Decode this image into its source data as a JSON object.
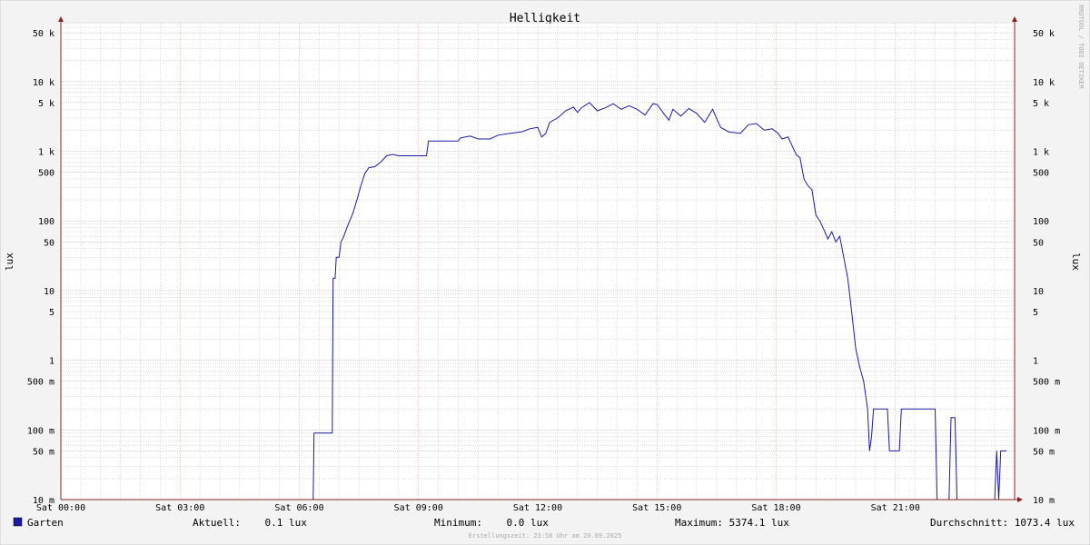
{
  "colors": {
    "background": "#f3f3f3",
    "canvas": "#ffffff",
    "major_grid": "#e6a0a0",
    "minor_grid": "#cccccc",
    "axis": "#8b2020",
    "series": "#1a1aa6",
    "text": "#000000",
    "watermark": "#aaaaaa"
  },
  "chart_data": {
    "type": "line",
    "title": "Helligkeit",
    "ylabel_left": "lux",
    "ylabel_right": "lux",
    "y_scale": "log",
    "ylim": [
      0.01,
      70000
    ],
    "xlim": [
      "00:00",
      "24:00"
    ],
    "x_ticks": [
      {
        "label": "Sat 00:00",
        "hour": 0
      },
      {
        "label": "Sat 03:00",
        "hour": 3
      },
      {
        "label": "Sat 06:00",
        "hour": 6
      },
      {
        "label": "Sat 09:00",
        "hour": 9
      },
      {
        "label": "Sat 12:00",
        "hour": 12
      },
      {
        "label": "Sat 15:00",
        "hour": 15
      },
      {
        "label": "Sat 18:00",
        "hour": 18
      },
      {
        "label": "Sat 21:00",
        "hour": 21
      }
    ],
    "y_ticks": [
      {
        "label": "50 k",
        "value": 50000
      },
      {
        "label": "10 k",
        "value": 10000
      },
      {
        "label": "5 k",
        "value": 5000
      },
      {
        "label": "1 k",
        "value": 1000
      },
      {
        "label": "500",
        "value": 500
      },
      {
        "label": "100",
        "value": 100
      },
      {
        "label": "50",
        "value": 50
      },
      {
        "label": "10",
        "value": 10
      },
      {
        "label": "5",
        "value": 5
      },
      {
        "label": "1",
        "value": 1
      },
      {
        "label": "500 m",
        "value": 0.5
      },
      {
        "label": "100 m",
        "value": 0.1
      },
      {
        "label": "50 m",
        "value": 0.05
      },
      {
        "label": "10 m",
        "value": 0.01
      }
    ],
    "grid": true,
    "legend": "bottom-left",
    "series": [
      {
        "name": "Garten",
        "color": "#1a1aa6",
        "points": [
          [
            0.0,
            0.01
          ],
          [
            6.35,
            0.01
          ],
          [
            6.37,
            0.09
          ],
          [
            6.83,
            0.09
          ],
          [
            6.85,
            15
          ],
          [
            6.9,
            15
          ],
          [
            6.93,
            30
          ],
          [
            7.0,
            30
          ],
          [
            7.05,
            50
          ],
          [
            7.12,
            60
          ],
          [
            7.18,
            75
          ],
          [
            7.25,
            95
          ],
          [
            7.35,
            130
          ],
          [
            7.45,
            200
          ],
          [
            7.55,
            320
          ],
          [
            7.65,
            480
          ],
          [
            7.75,
            580
          ],
          [
            7.9,
            600
          ],
          [
            8.05,
            700
          ],
          [
            8.2,
            860
          ],
          [
            8.35,
            900
          ],
          [
            8.5,
            860
          ],
          [
            8.8,
            860
          ],
          [
            9.2,
            860
          ],
          [
            9.25,
            1400
          ],
          [
            9.8,
            1400
          ],
          [
            10.0,
            1400
          ],
          [
            10.05,
            1550
          ],
          [
            10.3,
            1650
          ],
          [
            10.5,
            1500
          ],
          [
            10.8,
            1500
          ],
          [
            11.0,
            1700
          ],
          [
            11.3,
            1800
          ],
          [
            11.6,
            1900
          ],
          [
            11.8,
            2100
          ],
          [
            12.0,
            2200
          ],
          [
            12.1,
            1600
          ],
          [
            12.2,
            1800
          ],
          [
            12.3,
            2600
          ],
          [
            12.5,
            3000
          ],
          [
            12.7,
            3800
          ],
          [
            12.9,
            4300
          ],
          [
            13.0,
            3600
          ],
          [
            13.1,
            4200
          ],
          [
            13.3,
            5000
          ],
          [
            13.5,
            3800
          ],
          [
            13.7,
            4200
          ],
          [
            13.9,
            4800
          ],
          [
            14.1,
            4000
          ],
          [
            14.3,
            4500
          ],
          [
            14.5,
            4000
          ],
          [
            14.7,
            3300
          ],
          [
            14.9,
            4800
          ],
          [
            15.0,
            4700
          ],
          [
            15.2,
            3300
          ],
          [
            15.3,
            2800
          ],
          [
            15.4,
            4000
          ],
          [
            15.6,
            3200
          ],
          [
            15.8,
            4100
          ],
          [
            16.0,
            3500
          ],
          [
            16.2,
            2600
          ],
          [
            16.4,
            4000
          ],
          [
            16.6,
            2200
          ],
          [
            16.8,
            1900
          ],
          [
            17.1,
            1800
          ],
          [
            17.3,
            2400
          ],
          [
            17.5,
            2500
          ],
          [
            17.7,
            2000
          ],
          [
            17.9,
            2100
          ],
          [
            18.05,
            1800
          ],
          [
            18.15,
            1500
          ],
          [
            18.3,
            1600
          ],
          [
            18.4,
            1200
          ],
          [
            18.5,
            900
          ],
          [
            18.6,
            800
          ],
          [
            18.7,
            400
          ],
          [
            18.8,
            320
          ],
          [
            18.9,
            280
          ],
          [
            19.0,
            120
          ],
          [
            19.1,
            100
          ],
          [
            19.2,
            75
          ],
          [
            19.3,
            55
          ],
          [
            19.4,
            70
          ],
          [
            19.5,
            50
          ],
          [
            19.6,
            60
          ],
          [
            19.7,
            30
          ],
          [
            19.8,
            15
          ],
          [
            19.9,
            5
          ],
          [
            20.0,
            1.5
          ],
          [
            20.1,
            0.8
          ],
          [
            20.2,
            0.5
          ],
          [
            20.3,
            0.2
          ],
          [
            20.35,
            0.05
          ],
          [
            20.4,
            0.08
          ],
          [
            20.45,
            0.2
          ],
          [
            20.8,
            0.2
          ],
          [
            20.85,
            0.05
          ],
          [
            21.1,
            0.05
          ],
          [
            21.15,
            0.2
          ],
          [
            22.0,
            0.2
          ],
          [
            22.05,
            0.01
          ],
          [
            22.35,
            0.01
          ],
          [
            22.4,
            0.15
          ],
          [
            22.5,
            0.15
          ],
          [
            22.55,
            0.01
          ],
          [
            23.5,
            0.01
          ],
          [
            23.55,
            0.05
          ],
          [
            23.6,
            0.01
          ],
          [
            23.65,
            0.05
          ],
          [
            23.8,
            0.05
          ]
        ]
      }
    ]
  },
  "legend": {
    "series_name": "Garten",
    "aktuell": "Aktuell:    0.1 lux",
    "minimum": "Minimum:    0.0 lux",
    "maximum": "Maximum: 5374.1 lux",
    "durchschnitt": "Durchschnitt: 1073.4 lux"
  },
  "footer": "Erstellungszeit: 23:58 Uhr am 20.09.2025",
  "watermark": "RRDTOOL / TOBI OETIKER"
}
